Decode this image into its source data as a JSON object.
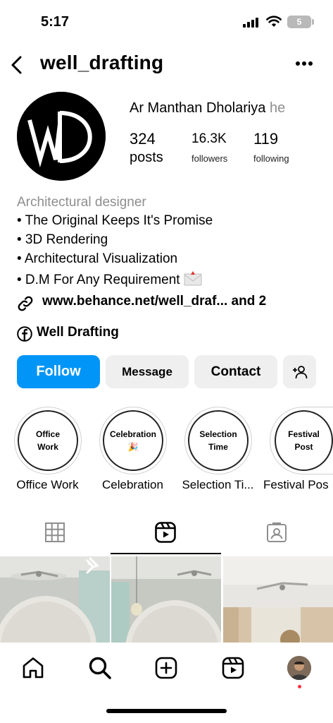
{
  "status_bar": {
    "time": "5:17",
    "battery": "5"
  },
  "header": {
    "username": "well_drafting"
  },
  "profile": {
    "full_name": "Ar Manthan Dholariya",
    "pronoun": "he",
    "posts_count": "324",
    "posts_label": "posts",
    "followers_count": "16.3K",
    "followers_label": "followers",
    "following_count": "119",
    "following_label": "following"
  },
  "bio": {
    "category": "Architectural designer",
    "lines": [
      "• The Original Keeps It's Promise",
      "• 3D Rendering",
      "• Architectural Visualization",
      "• D.M For Any Requirement"
    ],
    "link": "www.behance.net/well_draf...  and 2",
    "facebook_page": "Well Drafting"
  },
  "actions": {
    "follow": "Follow",
    "message": "Message",
    "contact": "Contact"
  },
  "highlights": [
    {
      "inner_line1": "Office",
      "inner_line2": "Work",
      "label": "Office Work"
    },
    {
      "inner_line1": "Celebration",
      "inner_line2": "🎉",
      "label": "Celebration"
    },
    {
      "inner_line1": "Selection",
      "inner_line2": "Time",
      "label": "Selection Ti..."
    },
    {
      "inner_line1": "Festival",
      "inner_line2": "Post",
      "label": "Festival Pos"
    }
  ],
  "tabs": {
    "active": "reels"
  },
  "colors": {
    "follow_blue": "#0095f6",
    "secondary_button": "#efefef",
    "notification_dot": "#ff3040"
  }
}
